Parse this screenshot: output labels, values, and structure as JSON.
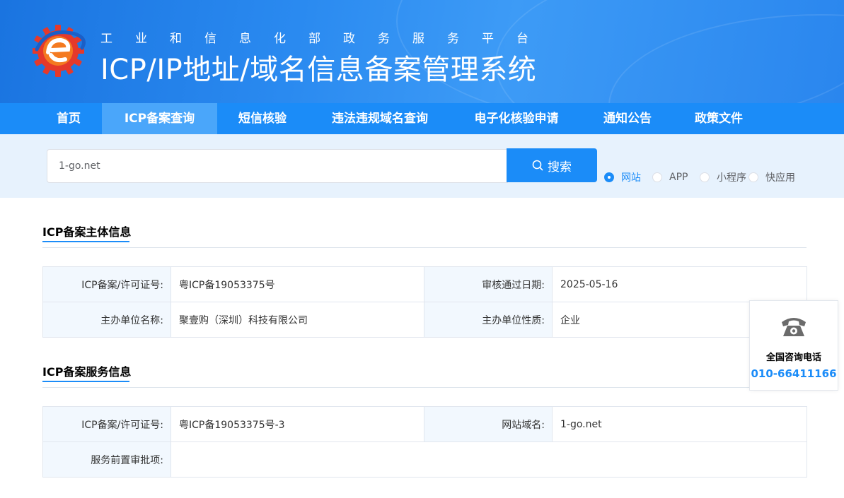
{
  "header": {
    "subtitle": "工业和信息化部政务服务平台",
    "title": "ICP/IP地址/域名信息备案管理系统"
  },
  "nav": [
    {
      "label": "首页",
      "active": false
    },
    {
      "label": "ICP备案查询",
      "active": true
    },
    {
      "label": "短信核验",
      "active": false
    },
    {
      "label": "违法违规域名查询",
      "active": false
    },
    {
      "label": "电子化核验申请",
      "active": false
    },
    {
      "label": "通知公告",
      "active": false
    },
    {
      "label": "政策文件",
      "active": false
    }
  ],
  "search": {
    "value": "1-go.net",
    "button_label": "搜索",
    "types": [
      {
        "label": "网站",
        "checked": true
      },
      {
        "label": "APP",
        "checked": false
      },
      {
        "label": "小程序",
        "checked": false
      },
      {
        "label": "快应用",
        "checked": false
      }
    ]
  },
  "subject_info": {
    "heading": "ICP备案主体信息",
    "license_label": "ICP备案/许可证号:",
    "license_value": "粤ICP备19053375号",
    "approval_date_label": "审核通过日期:",
    "approval_date_value": "2025-05-16",
    "org_name_label": "主办单位名称:",
    "org_name_value": "聚壹购（深圳）科技有限公司",
    "org_type_label": "主办单位性质:",
    "org_type_value": "企业"
  },
  "service_info": {
    "heading": "ICP备案服务信息",
    "license_label": "ICP备案/许可证号:",
    "license_value": "粤ICP备19053375号-3",
    "domain_label": "网站域名:",
    "domain_value": "1-go.net",
    "pre_approval_label": "服务前置审批项:",
    "pre_approval_value": ""
  },
  "hotline": {
    "label": "全国咨询电话",
    "number": "010-66411166",
    "icon": "telephone-icon"
  },
  "colors": {
    "primary": "#1b8cf8",
    "nav_active": "#4aa6fa",
    "search_band": "#e7f2fd",
    "label_cell": "#f2f8fe"
  }
}
